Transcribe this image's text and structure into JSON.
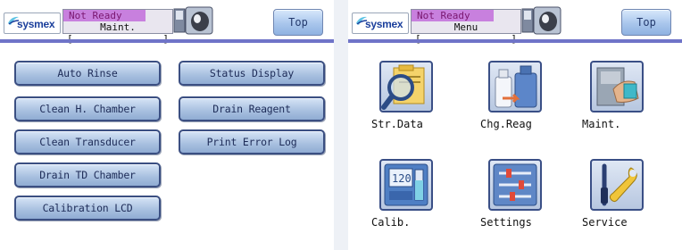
{
  "colors": {
    "status_bar": "#c880de",
    "divider": "#6f74c8",
    "button_gradient_top": "#d6e4f6",
    "button_border": "#3b4f82",
    "brand": "#1b3f9c"
  },
  "left_screen": {
    "logo_text": "sysmex",
    "status": "Not Ready",
    "mode_label": "Maint.",
    "top_button": "Top",
    "buttons": [
      "Auto Rinse",
      "Status Display",
      "Clean H. Chamber",
      "Drain Reagent",
      "Clean Transducer",
      "Print Error Log",
      "Drain TD Chamber",
      "Calibration LCD"
    ]
  },
  "right_screen": {
    "logo_text": "sysmex",
    "status": "Not Ready",
    "mode_label": "Menu",
    "top_button": "Top",
    "menu": [
      {
        "label": "Str.Data",
        "icon": "stored-data-magnifier-icon"
      },
      {
        "label": "Chg.Reag",
        "icon": "change-reagent-bottles-icon"
      },
      {
        "label": "Maint.",
        "icon": "maintenance-cleaning-icon"
      },
      {
        "label": "Calib.",
        "icon": "calibration-icon"
      },
      {
        "label": "Settings",
        "icon": "settings-sliders-icon"
      },
      {
        "label": "Service",
        "icon": "service-tools-icon"
      }
    ]
  }
}
